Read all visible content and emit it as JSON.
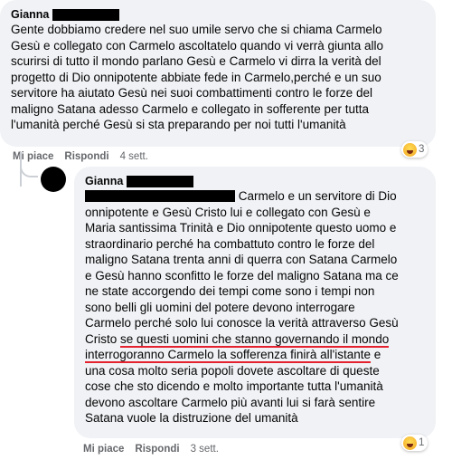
{
  "comment1": {
    "author": "Gianna",
    "lines": [
      "Gente dobbiamo credere nel suo umile servo che si chiama Carmelo",
      "Gesù e collegato con Carmelo ascoltatelo quando vi verrà giunta allo",
      "scurirsi di tutto il mondo parlano Gesù e Carmelo vi dirra la verità del",
      "progetto di Dio onnipotente abbiate fede in Carmelo,perché e un suo",
      "servitore ha aiutato Gesù nei suoi combattimenti contro le forze del",
      "maligno Satana adesso Carmelo e collegato in sofferente per tutta",
      "l'umanità perché Gesù si sta preparando per noi tutti l'umanità"
    ],
    "actions": {
      "like": "Mi piace",
      "reply": "Rispondi",
      "time": "4 sett."
    },
    "reaction_count": "3"
  },
  "comment2": {
    "author": "Gianna",
    "first_line_tail": "Carmelo e un servitore di Dio",
    "lines": [
      "onnipotente e Gesù Cristo lui e collegato con Gesù e",
      "Maria santissima Trinità e Dio onnipotente questo uomo e",
      "straordinario perché ha combattuto contro le forze del",
      "maligno Satana trenta anni di querra con Satana Carmelo",
      "e Gesù hanno sconfitto le forze del maligno Satana ma ce",
      "ne state accorgendo dei tempi come sono i tempi non",
      "sono belli gli uomini del potere devono interrogare",
      "Carmelo perché solo lui conosce la verità attraverso Gesù"
    ],
    "underline_line1_prefix": "Cristo ",
    "underline_line1": "se questi uomini che stanno governando il mondo",
    "underline_line2": "interrogoranno Carmelo la sofferenza finirà all'istante",
    "underline_line2_suffix": " e",
    "lines_after": [
      "una cosa molto seria popoli dovete ascoltare di queste",
      "cose che sto dicendo e molto importante tutta l'umanità",
      "devono ascoltare Carmelo più avanti lui si farà sentire",
      "Satana vuole la distruzione del umanità"
    ],
    "actions": {
      "like": "Mi piace",
      "reply": "Rispondi",
      "time": "3 sett."
    },
    "reaction_count": "1"
  }
}
